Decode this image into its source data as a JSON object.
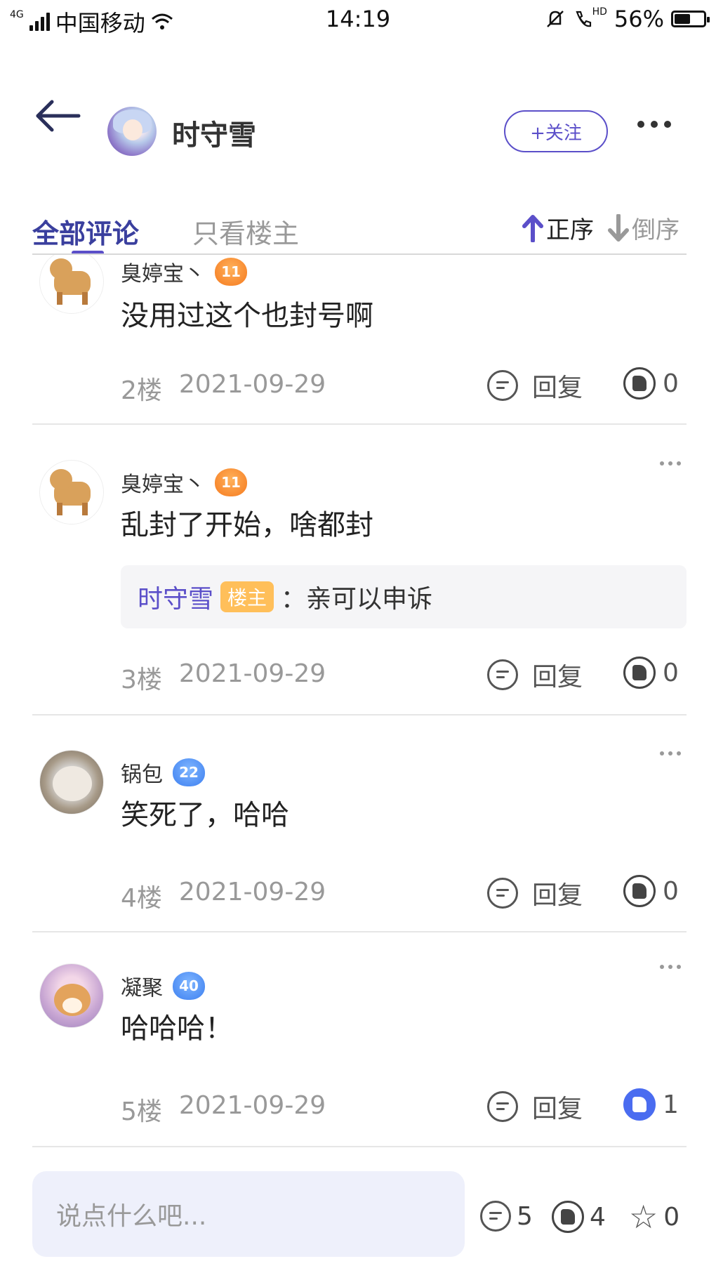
{
  "status_bar": {
    "network": "4G",
    "carrier": "中国移动",
    "time": "14:19",
    "hd": "HD",
    "battery_percent": "56%",
    "battery_level": 0.56
  },
  "header": {
    "username": "时守雪",
    "follow_label": "+关注"
  },
  "tabs": {
    "all_comments": "全部评论",
    "owner_only": "只看楼主",
    "sort_asc": "正序",
    "sort_desc": "倒序"
  },
  "comments": [
    {
      "name": "臭婷宝丶",
      "level": "11",
      "text": "没用过这个也封号啊",
      "floor": "2楼",
      "date": "2021-09-29",
      "reply_label": "回复",
      "likes": "0"
    },
    {
      "name": "臭婷宝丶",
      "level": "11",
      "text": "乱封了开始，啥都封",
      "quote": {
        "name": "时守雪",
        "badge": "楼主",
        "separator": "：",
        "text": "亲可以申诉"
      },
      "floor": "3楼",
      "date": "2021-09-29",
      "reply_label": "回复",
      "likes": "0"
    },
    {
      "name": "锅包",
      "level": "22",
      "text": "笑死了，哈哈",
      "floor": "4楼",
      "date": "2021-09-29",
      "reply_label": "回复",
      "likes": "0"
    },
    {
      "name": "凝聚",
      "level": "40",
      "text": "哈哈哈！",
      "floor": "5楼",
      "date": "2021-09-29",
      "reply_label": "回复",
      "likes": "1"
    }
  ],
  "bottom_bar": {
    "input_placeholder": "说点什么吧...",
    "comment_count": "5",
    "like_count": "4",
    "favorite_count": "0"
  },
  "colors": {
    "accent": "#5b4fc9",
    "tab_active": "#3a3f9e",
    "like_active": "#4a6cf0",
    "level_orange": "#f57a1f",
    "level_blue": "#3d7ff0",
    "owner_badge": "#ffbf5a"
  },
  "icons": {
    "back": "arrow-left-icon",
    "more": "more-dots-icon",
    "sort_up": "arrow-up-icon",
    "sort_down": "arrow-down-icon",
    "comment": "comment-bubble-icon",
    "like": "thumbs-up-icon",
    "favorite": "star-icon"
  }
}
